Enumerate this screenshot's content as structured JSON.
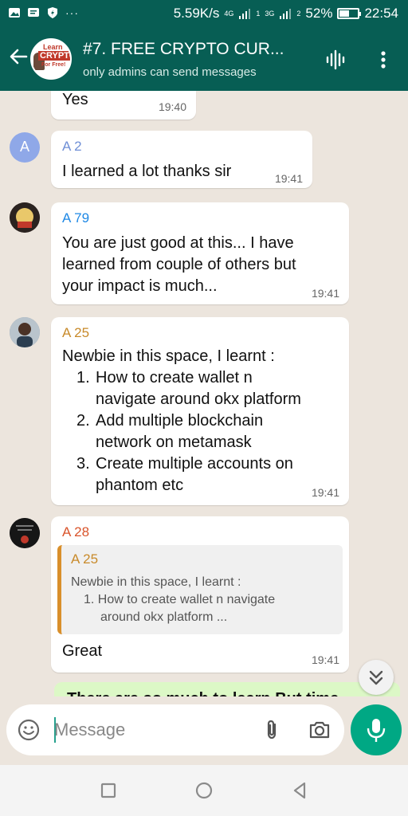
{
  "status_bar": {
    "speed": "5.59K/s",
    "net_4g": "4G",
    "net_3g": "3G",
    "sim1": "1",
    "sim2": "2",
    "battery_percent": "52%",
    "battery_level": 0.52,
    "time": "22:54",
    "more_indicator": "···"
  },
  "header": {
    "title": "#7. FREE CRYPTO CUR...",
    "subtitle": "only admins can send messages",
    "avatar_logo": {
      "line1": "Learn",
      "line2": "CRYPTO",
      "line3": "For Free!"
    },
    "icons": {
      "back": "arrow-left-icon",
      "voice": "audio-wave-icon",
      "menu": "more-vert-icon"
    }
  },
  "messages": [
    {
      "id": "m0",
      "text": "Yes",
      "time": "19:40"
    },
    {
      "id": "m1",
      "sender": "A 2",
      "sender_color": "#6f8fd6",
      "avatar_letter": "A",
      "text": "I learned a lot thanks sir",
      "time": "19:41"
    },
    {
      "id": "m2",
      "sender": "A 79",
      "sender_color": "#1e88e5",
      "lines": [
        "You are just good at this... I have",
        "learned from couple of others but",
        "your impact is much..."
      ],
      "time": "19:41"
    },
    {
      "id": "m3",
      "sender": "A 25",
      "sender_color": "#c88a2a",
      "intro": "Newbie in this space,  I learnt :",
      "items": [
        {
          "num": "1.",
          "lines": [
            "How to create wallet n",
            "navigate around okx platform"
          ]
        },
        {
          "num": "2.",
          "lines": [
            "Add multiple  blockchain",
            "network on metamask"
          ]
        },
        {
          "num": "3.",
          "lines": [
            "Create multiple accounts on",
            "phantom etc"
          ]
        }
      ],
      "time": "19:41"
    },
    {
      "id": "m4",
      "sender": "A 28",
      "sender_color": "#d9542b",
      "quote": {
        "sender": "A 25",
        "lines": [
          "Newbie in this space,  I learnt :",
          "1. How to create wallet n navigate",
          "around okx platform ..."
        ]
      },
      "text": "Great",
      "time": "19:41"
    },
    {
      "id": "m5",
      "text": "There are so much to learn     But time"
    }
  ],
  "input": {
    "placeholder": "Message"
  },
  "colors": {
    "header": "#075e54",
    "accent": "#00a884",
    "chat_bg": "#ece5dd",
    "outgoing": "#dcf8c6"
  }
}
